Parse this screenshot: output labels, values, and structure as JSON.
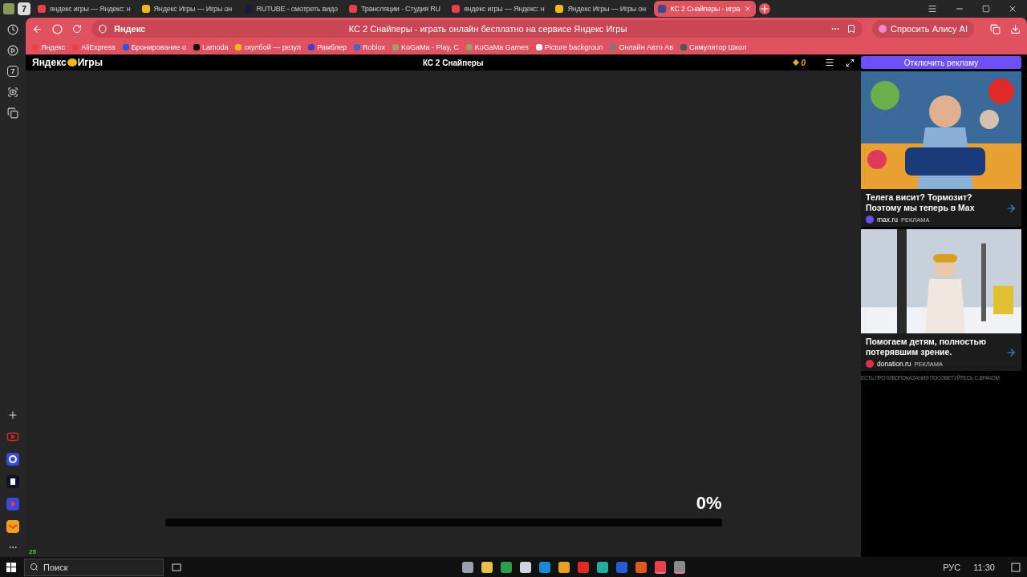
{
  "tab_strip": {
    "tab_count": "7",
    "tabs": [
      {
        "title": "яндекс игры — Яндекс: н",
        "color": "#e8414b",
        "selected": false
      },
      {
        "title": "Яндекс Игры — Игры он",
        "color": "#f2b71a",
        "selected": false
      },
      {
        "title": "RUTUBE - смотреть видо",
        "color": "#1a1a3a",
        "selected": false
      },
      {
        "title": "Трансляции - Студия RU",
        "color": "#e8414b",
        "selected": false
      },
      {
        "title": "яндекс игры — Яндекс: н",
        "color": "#e8414b",
        "selected": false
      },
      {
        "title": "Яндекс Игры — Игры он",
        "color": "#f2b71a",
        "selected": false
      },
      {
        "title": "КС 2 Снайперы - игра",
        "color": "#3a4a8a",
        "selected": true
      }
    ]
  },
  "address_bar": {
    "site": "Яндекс",
    "page_title": "КС 2 Снайперы - играть онлайн бесплатно на сервисе Яндекс Игры",
    "assistant_button": "Спросить Алису AI"
  },
  "bookmarks": [
    {
      "label": "Яндекс",
      "color": "#e8414b"
    },
    {
      "label": "AliExpress",
      "color": "#e8414b"
    },
    {
      "label": "Бронирование о",
      "color": "#2a5bd7"
    },
    {
      "label": "Lamoda",
      "color": "#111111"
    },
    {
      "label": "скулбой — резул",
      "color": "#f2b71a"
    },
    {
      "label": "Рамблер",
      "color": "#4a3ad0"
    },
    {
      "label": "Roblox",
      "color": "#3a6ad0"
    },
    {
      "label": "KoGaMa - Play, C",
      "color": "#9aa06a"
    },
    {
      "label": "KoGaMa Games",
      "color": "#9aa06a"
    },
    {
      "label": "Picture backgroun",
      "color": "#f5f5f5"
    },
    {
      "label": "Онлайн Авто Ав",
      "color": "#7a7a7a"
    },
    {
      "label": "Симулятор Школ",
      "color": "#4a5a4a"
    }
  ],
  "game_header": {
    "logo_left": "Яндекс",
    "logo_right": "Игры",
    "title": "КС 2 Снайперы",
    "coins": "0",
    "disable_ads_button": "Отключить рекламу"
  },
  "loader": {
    "percent": "0%",
    "level": 0
  },
  "ads": [
    {
      "kind": "picture",
      "headline": "Телега висит? Тормозит? Поэтому мы теперь в Max",
      "domain": "max.ru",
      "label": "РЕКЛАМА",
      "color": "#6a4ef0"
    },
    {
      "kind": "picture",
      "headline": "Помогаем детям, полностью потерявшим зрение.",
      "domain": "donation.ru",
      "label": "РЕКЛАМА",
      "color": "#e0304a"
    }
  ],
  "ad_disclaimer": "ЕСТЬ ПРОТИВОПОКАЗАНИЯ ПОСОВЕТУЙТЕСЬ С ВРАЧОМ",
  "sidebar": {
    "tab_count": "7",
    "badge": "25"
  },
  "taskbar": {
    "search_placeholder": "Поиск",
    "language": "РУС",
    "time": "11:30",
    "apps": [
      {
        "color": "#9aa0b0",
        "running": false
      },
      {
        "color": "#e8c04a",
        "running": false
      },
      {
        "color": "#2aa04a",
        "running": false
      },
      {
        "color": "#d0d4dc",
        "running": false
      },
      {
        "color": "#1a8ad8",
        "running": false
      },
      {
        "color": "#e8a020",
        "running": false
      },
      {
        "color": "#e02a2a",
        "running": false
      },
      {
        "color": "#20b0a0",
        "running": false
      },
      {
        "color": "#2a5bd7",
        "running": false
      },
      {
        "color": "#e05a20",
        "running": false
      },
      {
        "color": "#e8414b",
        "running": true
      },
      {
        "color": "#8a8a8a",
        "running": true
      }
    ]
  }
}
